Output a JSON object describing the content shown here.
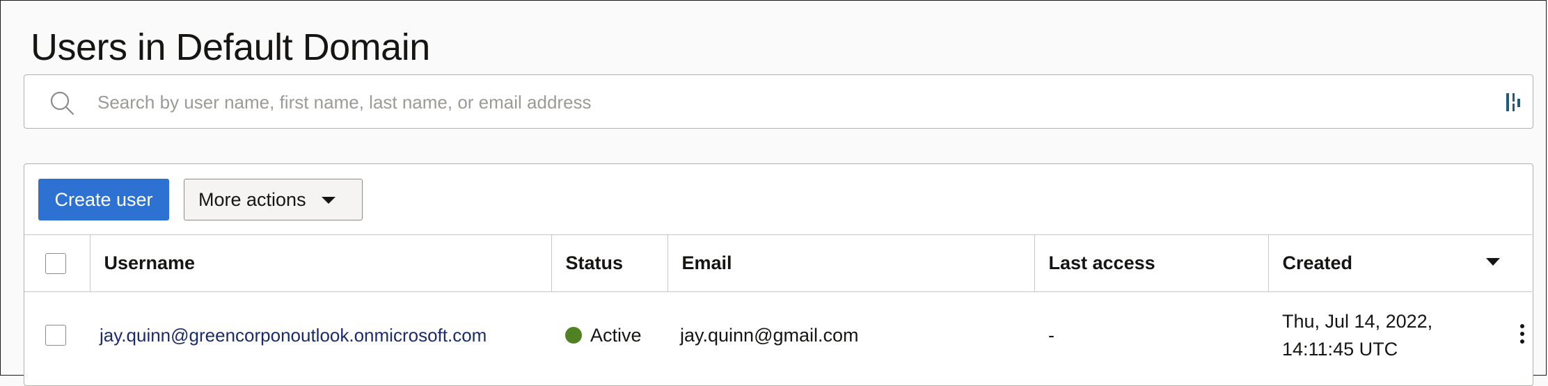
{
  "page": {
    "title": "Users in Default Domain"
  },
  "search": {
    "icon": "search-icon",
    "value": "",
    "placeholder": "Search by user name, first name, last name, or email address",
    "filter_icon": "filter-icon"
  },
  "toolbar": {
    "create_label": "Create user",
    "more_actions_label": "More actions"
  },
  "table": {
    "columns": {
      "username": "Username",
      "status": "Status",
      "email": "Email",
      "last_access": "Last access",
      "created": "Created"
    },
    "sort_indicator": "caret-down",
    "rows": [
      {
        "username": "jay.quinn@greencorponoutlook.onmicrosoft.com",
        "status": "Active",
        "email": "jay.quinn@gmail.com",
        "last_access": "-",
        "created_date": "Thu, Jul 14, 2022,",
        "created_time": "14:11:45 UTC"
      }
    ]
  },
  "colors": {
    "primary_button": "#2d72d2",
    "status_active": "#508223",
    "link": "#1c2b6b",
    "filter_icon": "#1f5c7a"
  }
}
